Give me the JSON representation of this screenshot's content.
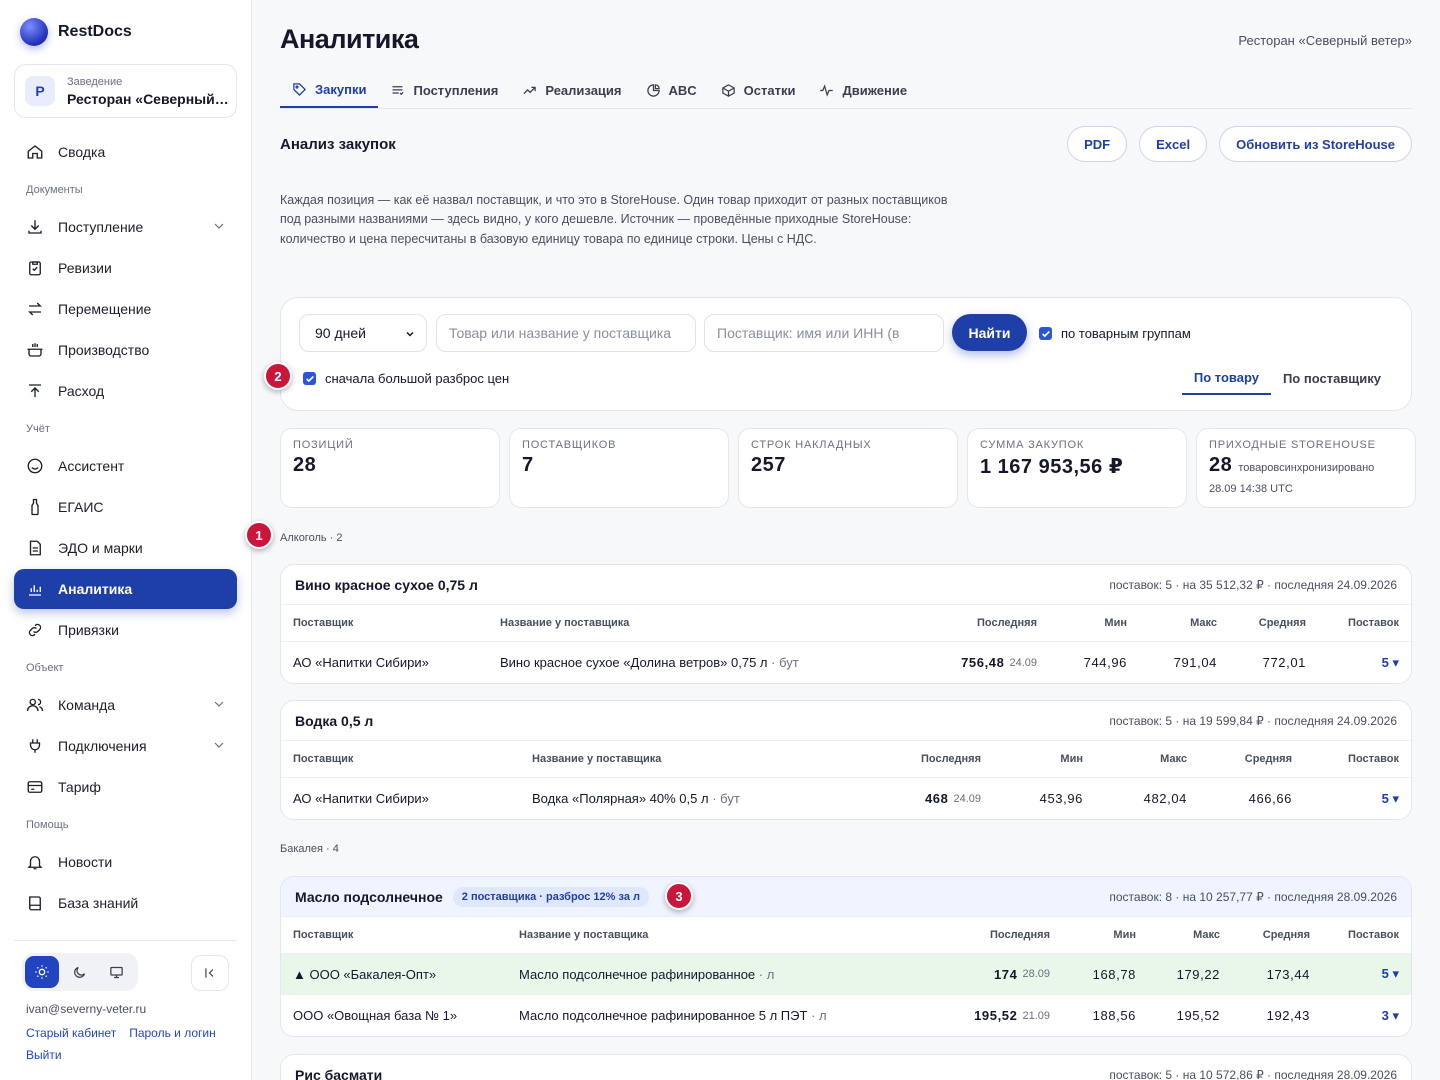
{
  "brand": {
    "name": "RestDocs"
  },
  "venue": {
    "caption": "Заведение",
    "initial": "Р",
    "name": "Ресторан «Северный ветер»"
  },
  "nav": {
    "summary": "Сводка",
    "sec_docs": "Документы",
    "incoming": "Поступление",
    "revisions": "Ревизии",
    "transfer": "Перемещение",
    "production": "Производство",
    "expense": "Расход",
    "sec_accounting": "Учёт",
    "assistant": "Ассистент",
    "egais": "ЕГАИС",
    "edo": "ЭДО и марки",
    "analytics": "Аналитика",
    "bindings": "Привязки",
    "sec_object": "Объект",
    "team": "Команда",
    "connections": "Подключения",
    "tariff": "Тариф",
    "sec_help": "Помощь",
    "news": "Новости",
    "kb": "База знаний"
  },
  "user": {
    "email": "ivan@severny-veter.ru",
    "old_cabinet": "Старый кабинет",
    "password": "Пароль и логин",
    "logout": "Выйти"
  },
  "header": {
    "title": "Аналитика",
    "venue": "Ресторан «Северный ветер»"
  },
  "tabs": [
    "Закупки",
    "Поступления",
    "Реализация",
    "ABC",
    "Остатки",
    "Движение"
  ],
  "section": {
    "title": "Анализ закупок",
    "pdf": "PDF",
    "excel": "Excel",
    "refresh": "Обновить из StoreHouse",
    "description": "Каждая позиция — как её назвал поставщик, и что это в StoreHouse. Один товар приходит от разных поставщиков под разными названиями — здесь видно, у кого дешевле. Источник — проведённые приходные StoreHouse: количество и цена пересчитаны в базовую единицу товара по единице строки. Цены с НДС."
  },
  "filters": {
    "period": "90 дней",
    "product_placeholder": "Товар или название у поставщика",
    "supplier_placeholder": "Поставщик: имя или ИНН (в",
    "find": "Найти",
    "by_groups": "по товарным группам",
    "spread_first": "сначала большой разброс цен",
    "view_product": "По товару",
    "view_supplier": "По поставщику"
  },
  "stats": [
    {
      "label": "Позиций",
      "value": "28"
    },
    {
      "label": "Поставщиков",
      "value": "7"
    },
    {
      "label": "Строк накладных",
      "value": "257"
    },
    {
      "label": "Сумма закупок",
      "value": "1 167 953,56 ₽"
    },
    {
      "label": "Приходные StoreHouse",
      "value": "28",
      "extra": "товаровсинхронизировано",
      "sub": "28.09 14:38 UTC"
    }
  ],
  "columns": {
    "supplier": "Поставщик",
    "name": "Название у поставщика",
    "last": "Последняя",
    "min": "Мин",
    "max": "Макс",
    "avg": "Средняя",
    "deliveries": "Поставок"
  },
  "groups": [
    {
      "label": "Алкоголь · 2"
    },
    {
      "label": "Бакалея · 4"
    }
  ],
  "cards": [
    {
      "title": "Вино красное сухое 0,75 л",
      "meta": "поставок: 5 · на 35 512,32 ₽ · последняя 24.09.2026",
      "rows": [
        {
          "supplier": "АО «Напитки Сибири»",
          "name": "Вино красное сухое «Долина ветров» 0,75 л",
          "unit": "· бут",
          "last": "756,48",
          "last_date": "24.09",
          "min": "744,96",
          "max": "791,04",
          "avg": "772,01",
          "deliveries": "5 ▾"
        }
      ]
    },
    {
      "title": "Водка 0,5 л",
      "meta": "поставок: 5 · на 19 599,84 ₽ · последняя 24.09.2026",
      "rows": [
        {
          "supplier": "АО «Напитки Сибири»",
          "name": "Водка «Полярная» 40% 0,5 л",
          "unit": "· бут",
          "last": "468",
          "last_date": "24.09",
          "min": "453,96",
          "max": "482,04",
          "avg": "466,66",
          "deliveries": "5 ▾"
        }
      ]
    },
    {
      "title": "Масло подсолнечное",
      "badge": "2 поставщика · разброс 12% за л",
      "meta": "поставок: 8 · на 10 257,77 ₽ · последняя 28.09.2026",
      "rows": [
        {
          "supplier": "▲ ООО «Бакалея-Опт»",
          "name": "Масло подсолнечное рафинированное",
          "unit": "· л",
          "last": "174",
          "last_date": "28.09",
          "min": "168,78",
          "max": "179,22",
          "avg": "173,44",
          "deliveries": "5 ▾"
        },
        {
          "supplier": "ООО «Овощная база № 1»",
          "name": "Масло подсолнечное рафинированное 5 л ПЭТ",
          "unit": "· л",
          "last": "195,52",
          "last_date": "21.09",
          "min": "188,56",
          "max": "195,52",
          "avg": "192,43",
          "deliveries": "3 ▾"
        }
      ]
    },
    {
      "title": "Рис басмати",
      "meta": "поставок: 5 · на 10 572,86 ₽ · последняя 28.09.2026"
    }
  ],
  "markers": [
    "1",
    "2",
    "3"
  ],
  "colors": {
    "accent": "#1f3fa8",
    "marker": "#c8173a",
    "row_highlight": "#e8f7ea"
  }
}
